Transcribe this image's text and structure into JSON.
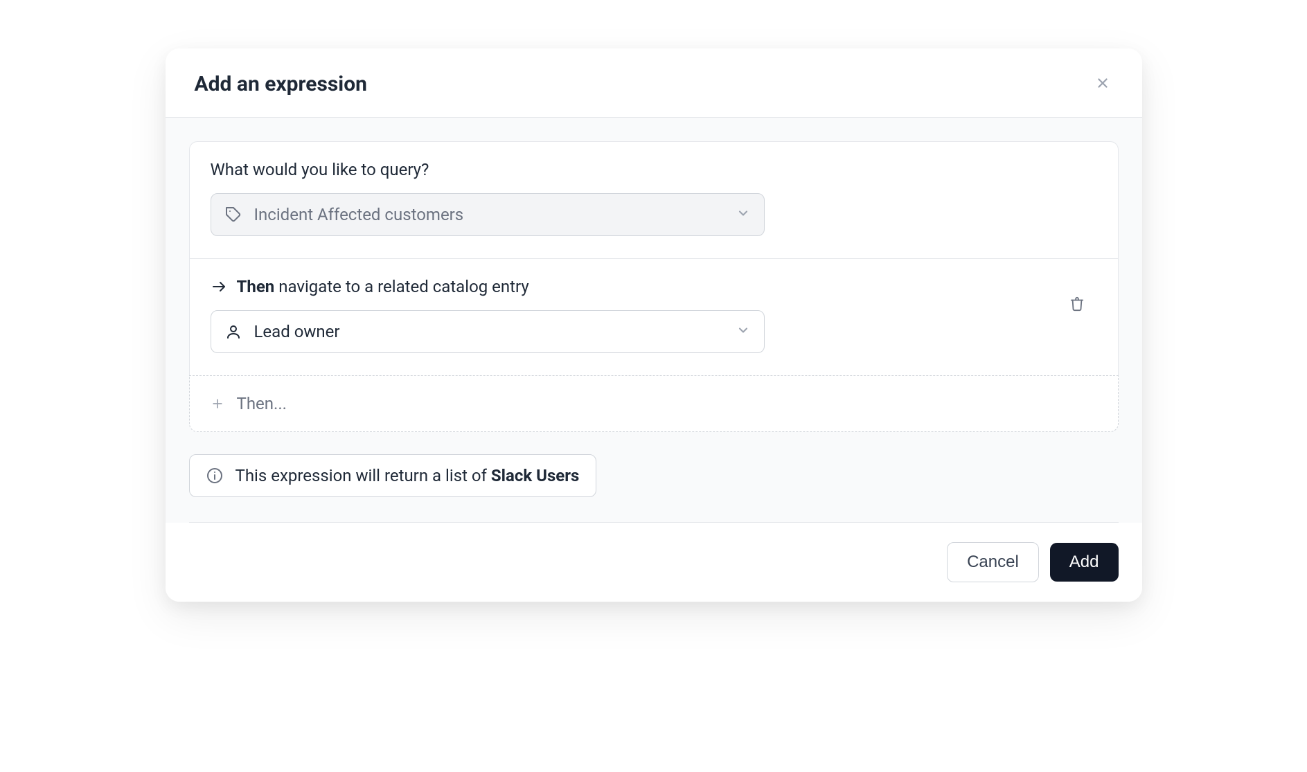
{
  "modal": {
    "title": "Add an expression"
  },
  "query": {
    "label": "What would you like to query?",
    "selected": "Incident Affected customers"
  },
  "navigate": {
    "then_bold": "Then",
    "then_rest": " navigate to a related catalog entry",
    "selected": "Lead owner"
  },
  "add_then": {
    "label": "Then..."
  },
  "info": {
    "prefix": "This expression will return a list of ",
    "bold": "Slack Users"
  },
  "footer": {
    "cancel": "Cancel",
    "add": "Add"
  }
}
